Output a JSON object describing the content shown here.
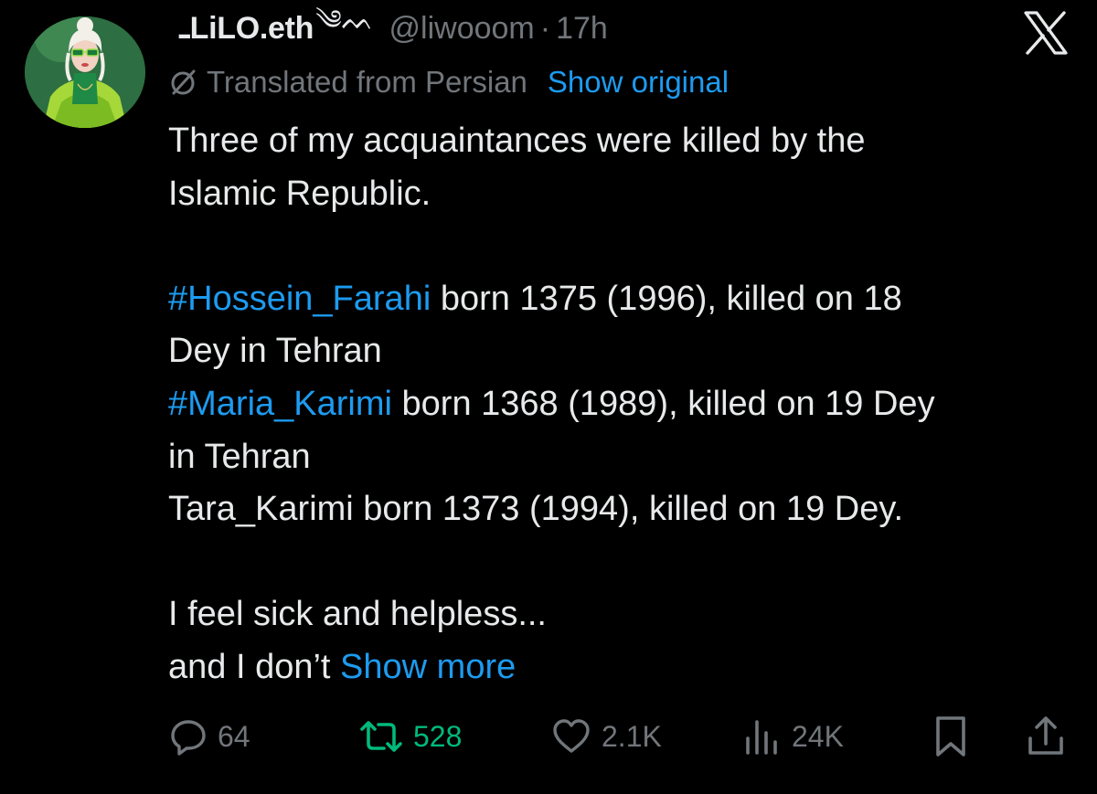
{
  "tweet": {
    "display_name": "ـLiLO.eth",
    "name_glyph": "༄ᨓ",
    "handle": "@liwooom",
    "separator": "·",
    "time": "17h",
    "translation_note": "Translated from Persian",
    "show_original_label": "Show original",
    "body": {
      "line1": "Three of my acquaintances were killed by the",
      "line2": "Islamic Republic.",
      "hashtag1": "#Hossein_Farahi",
      "line3_rest": " born 1375 (1996), killed on 18",
      "line4": "Dey in Tehran",
      "hashtag2": "#Maria_Karimi",
      "line5_rest": " born 1368 (1989), killed on 19 Dey",
      "line6": "in Tehran",
      "line7": "Tara_Karimi born 1373 (1994), killed on 19 Dey.",
      "line8": "I feel sick and helpless...",
      "line9_start": "and I don’t ",
      "show_more_label": "Show more"
    },
    "actions": {
      "replies": "64",
      "retweets": "528",
      "likes": "2.1K",
      "views": "24K"
    }
  },
  "colors": {
    "background": "#000000",
    "text_primary": "#e7e9ea",
    "text_secondary": "#71767b",
    "link": "#1d9bf0",
    "retweet_active": "#00ba7c"
  },
  "icons": {
    "close": "x-logo-icon",
    "translate": "translate-slash-icon",
    "reply": "reply-bubble-icon",
    "retweet": "retweet-icon",
    "like": "heart-icon",
    "views": "bar-chart-icon",
    "bookmark": "bookmark-icon",
    "share": "share-upload-icon"
  }
}
